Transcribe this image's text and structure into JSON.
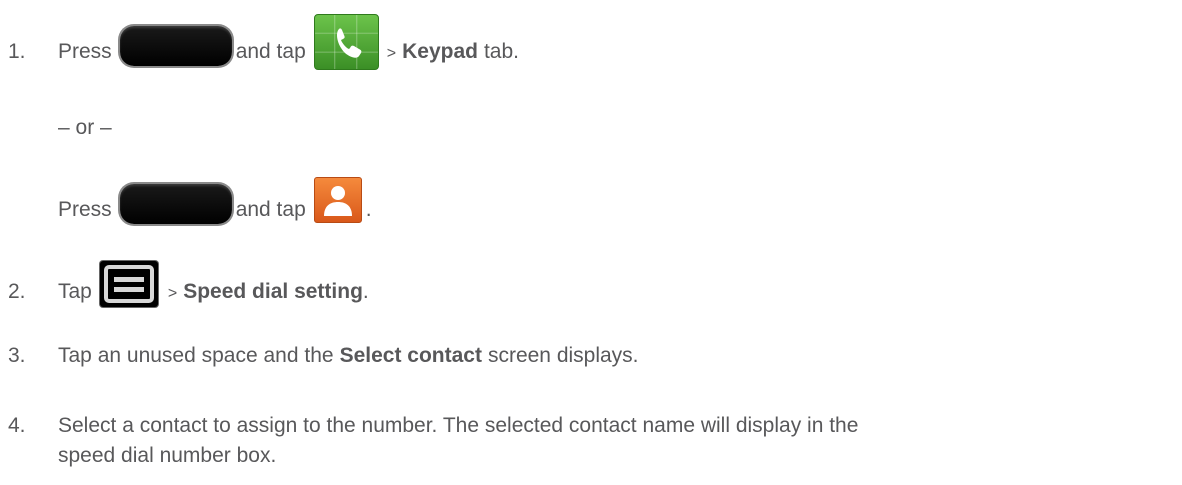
{
  "steps": [
    {
      "number": "1.",
      "parts": {
        "a": "Press",
        "b": "and tap",
        "c": ">",
        "d": "Keypad",
        "e": "tab."
      }
    },
    {
      "number": "2.",
      "parts": {
        "a": "Tap",
        "c": ">",
        "d": "Speed dial setting",
        "e": "."
      }
    },
    {
      "number": "3.",
      "parts": {
        "a": "Tap an unused space and the",
        "d": "Select contact",
        "e": "screen displays."
      }
    },
    {
      "number": "4.",
      "parts": {
        "a": "Select a contact to assign to the number. The selected contact name will display in the",
        "b": "speed dial number box."
      }
    }
  ],
  "alternate": {
    "separator": "– or –",
    "a": "Press",
    "b": "and tap",
    "e": "."
  },
  "icons": {
    "home": "home-key-icon",
    "phone": "phone-app-icon",
    "contacts": "contacts-app-icon",
    "menu": "menu-key-icon"
  },
  "colors": {
    "text": "#58585a",
    "phone_green": "#4ea532",
    "contacts_orange": "#e8682a"
  }
}
